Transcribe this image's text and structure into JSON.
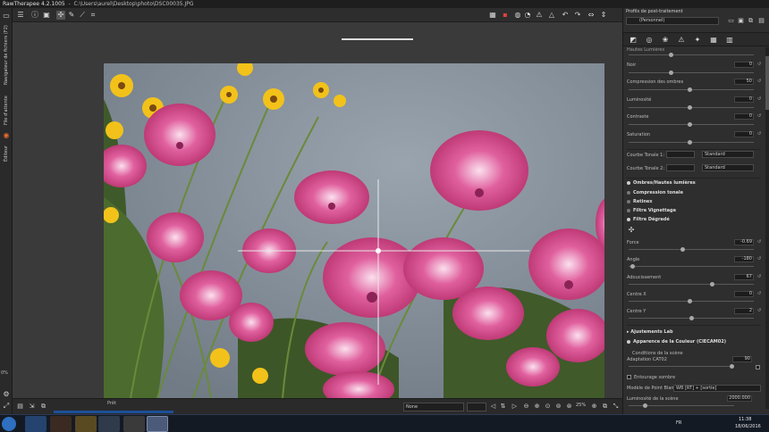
{
  "window": {
    "app_title": "RawTherapee 4.2.1005",
    "file_path": "C:\\Users\\aurel\\Desktop\\photo\\DSC00035.JPG"
  },
  "left_strip": {
    "tabs": [
      "Navigateur de fichiers (F2)",
      "File d'attente",
      "Éditeur"
    ],
    "zoom_percent": "0%"
  },
  "editor": {
    "toolbar_icons_left": [
      "history-icon",
      "info-icon",
      "before-after-icon",
      "crosshair-icon",
      "pipette-icon",
      "straighten-icon",
      "crop-icon"
    ],
    "toolbar_icons_right": [
      "zoom-fit-icon",
      "color-display-icon",
      "focus-icon",
      "warning-shadow-icon",
      "warning-highlight-icon",
      "rotate-left-icon",
      "rotate-right-icon",
      "flip-h-icon",
      "flip-v-icon"
    ]
  },
  "bottom_bar": {
    "progress_label": "Prêt",
    "output_profile": "None",
    "zoom": "25%"
  },
  "right_panel": {
    "header": "Profils de post-traitement",
    "profile_value": "(Personnel)",
    "tab_icons": [
      "exposure-tab-icon",
      "detail-tab-icon",
      "color-tab-icon",
      "transform-tab-icon",
      "raw-tab-icon",
      "metadata-tab-icon"
    ],
    "group_title_top": "Hautes Lumières",
    "sliders_top": [
      {
        "label": "Noir",
        "value": "0"
      },
      {
        "label": "Compression des ombres",
        "value": "50"
      },
      {
        "label": "Luminosité",
        "value": "0"
      },
      {
        "label": "Contraste",
        "value": "0"
      },
      {
        "label": "Saturation",
        "value": "0"
      }
    ],
    "curves": [
      {
        "label": "Courbe Tonale 1:",
        "mode": "Standard"
      },
      {
        "label": "Courbe Tonale 2:",
        "mode": "Standard"
      }
    ],
    "sections": [
      "Ombres/Hautes lumières",
      "Compression tonale",
      "Retinex",
      "Filtre Vignettage",
      "Filtre Dégradé"
    ],
    "gradient_sliders": [
      {
        "label": "Force",
        "value": "-0.69"
      },
      {
        "label": "Angle",
        "value": "-180"
      },
      {
        "label": "Adoucissement",
        "value": "67"
      },
      {
        "label": "Centre X",
        "value": "0"
      },
      {
        "label": "Centre Y",
        "value": "2"
      }
    ],
    "lower_sections": [
      "Ajustements Lab",
      "Apparence de la Couleur (CIECAM02)"
    ],
    "ciecam": {
      "subtitle": "Conditions de la scène",
      "adaptation_label": "Adaptation CAT02",
      "adaptation_value": "90",
      "surround_label": "Entourage sombre",
      "wb_label": "Modèle de Point Blanc",
      "wb_value": "WB [RT] + [sortie]",
      "luminance_label": "Luminosité de la scène",
      "luminance_value": "2000.000"
    }
  },
  "taskbar": {
    "lang": "FR",
    "time": "11:38",
    "date": "18/06/2016"
  },
  "colors": {
    "accent": "#1d4f9a",
    "flower_pink": "#e0609e",
    "flower_yellow": "#f2c21a",
    "sky": "#7f8a95"
  }
}
